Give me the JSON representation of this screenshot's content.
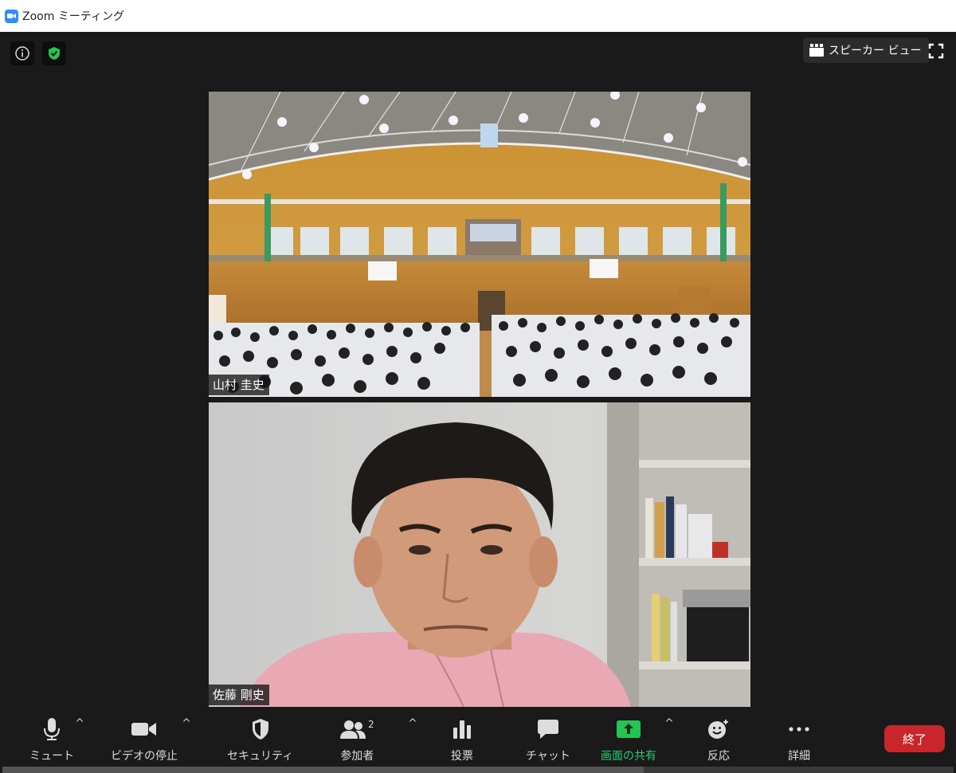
{
  "window": {
    "title": "Zoom ミーティング"
  },
  "topbar": {
    "speaker_view_label": "スピーカー ビュー"
  },
  "participants": [
    {
      "name": "山村 圭史"
    },
    {
      "name": "佐藤 剛史"
    }
  ],
  "toolbar": {
    "mute_label": "ミュート",
    "video_label": "ビデオの停止",
    "security_label": "セキュリティ",
    "participants_label": "参加者",
    "participants_count": "2",
    "polls_label": "投票",
    "chat_label": "チャット",
    "share_label": "画面の共有",
    "reactions_label": "反応",
    "more_label": "詳細",
    "end_label": "終了"
  },
  "colors": {
    "accent": "#2d8cff",
    "share_green": "#2ecc71",
    "end_red": "#c8262b",
    "background": "#1a1a1a"
  }
}
